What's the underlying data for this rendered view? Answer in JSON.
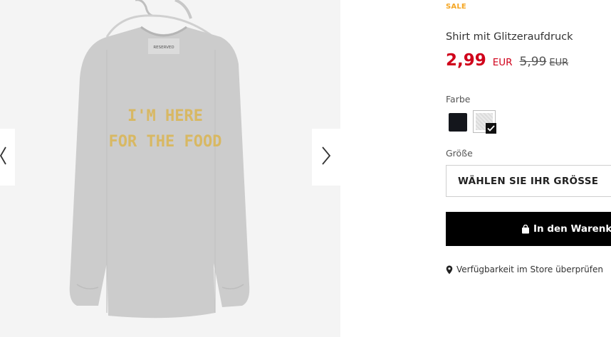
{
  "gallery": {
    "shirt_print_line1": "I'M HERE",
    "shirt_print_line2": "FOR THE FOOD",
    "label_brand": "RESERVED",
    "prev_icon": "chevron-left-icon",
    "next_icon": "chevron-right-icon"
  },
  "product": {
    "badge": "SALE",
    "title": "Shirt mit Glitzeraufdruck",
    "price_current": "2,99",
    "currency_current": "EUR",
    "price_old": "5,99",
    "currency_old": "EUR"
  },
  "color": {
    "label": "Farbe",
    "options": [
      {
        "name": "black",
        "hex": "#14161c",
        "selected": false
      },
      {
        "name": "grey",
        "hex": "#dcdcdc",
        "selected": true
      }
    ]
  },
  "size": {
    "label": "Größe",
    "placeholder": "WÄHLEN SIE IHR GRÖSSE"
  },
  "cart": {
    "label": "In den Warenkorb",
    "icon": "shopping-bag-icon"
  },
  "store": {
    "label": "Verfügbarkeit im Store überprüfen",
    "icon": "map-pin-icon"
  },
  "colors": {
    "sale_badge": "#f5a623",
    "price": "#d0021b",
    "button": "#000000"
  }
}
